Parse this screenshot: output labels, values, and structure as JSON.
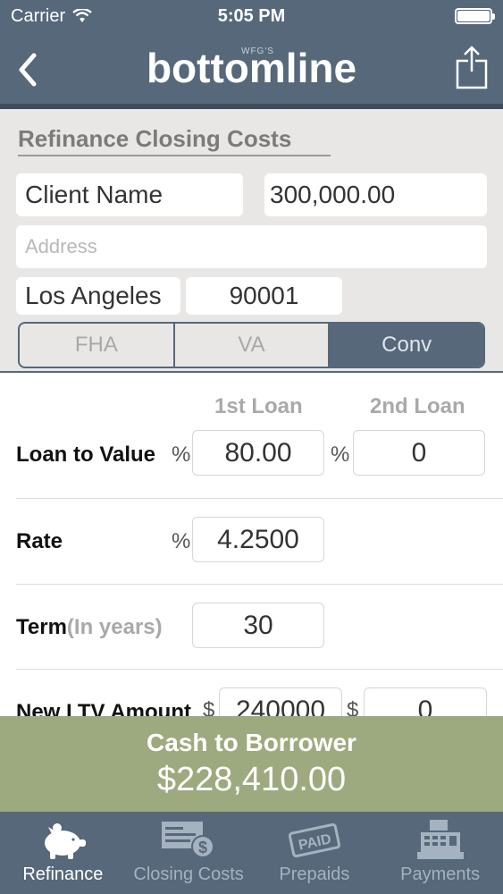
{
  "status_bar": {
    "carrier": "Carrier",
    "time": "5:05 PM"
  },
  "header": {
    "brand_small": "WFG'S",
    "brand_title": "bottomline"
  },
  "form": {
    "section_title": "Refinance Closing Costs",
    "client_name": "Client Name",
    "amount": "300,000.00",
    "address_placeholder": "Address",
    "city": "Los Angeles",
    "zip": "90001",
    "loan_types": [
      "FHA",
      "VA",
      "Conv"
    ],
    "selected_loan_type": "Conv"
  },
  "loans": {
    "col_1": "1st Loan",
    "col_2": "2nd Loan",
    "rows": {
      "ltv": {
        "label": "Loan to Value",
        "unit": "%",
        "first": "80.00",
        "second_unit": "%",
        "second": "0"
      },
      "rate": {
        "label": "Rate",
        "unit": "%",
        "first": "4.2500"
      },
      "term": {
        "label": "Term",
        "hint": "(In years)",
        "first": "30"
      },
      "new_ltv": {
        "label": "New LTV Amount",
        "unit": "$",
        "first": "240000",
        "second_unit": "$",
        "second": "0"
      }
    }
  },
  "cash": {
    "label": "Cash to Borrower",
    "value": "$228,410.00"
  },
  "tabs": [
    {
      "label": "Refinance",
      "icon": "piggy-bank-icon",
      "active": true
    },
    {
      "label": "Closing Costs",
      "icon": "check-dollar-icon",
      "active": false
    },
    {
      "label": "Prepaids",
      "icon": "paid-stamp-icon",
      "active": false
    },
    {
      "label": "Payments",
      "icon": "cash-register-icon",
      "active": false
    }
  ],
  "colors": {
    "header": "#56687a",
    "banner": "#9daa7f",
    "background": "#e9e7e6"
  }
}
